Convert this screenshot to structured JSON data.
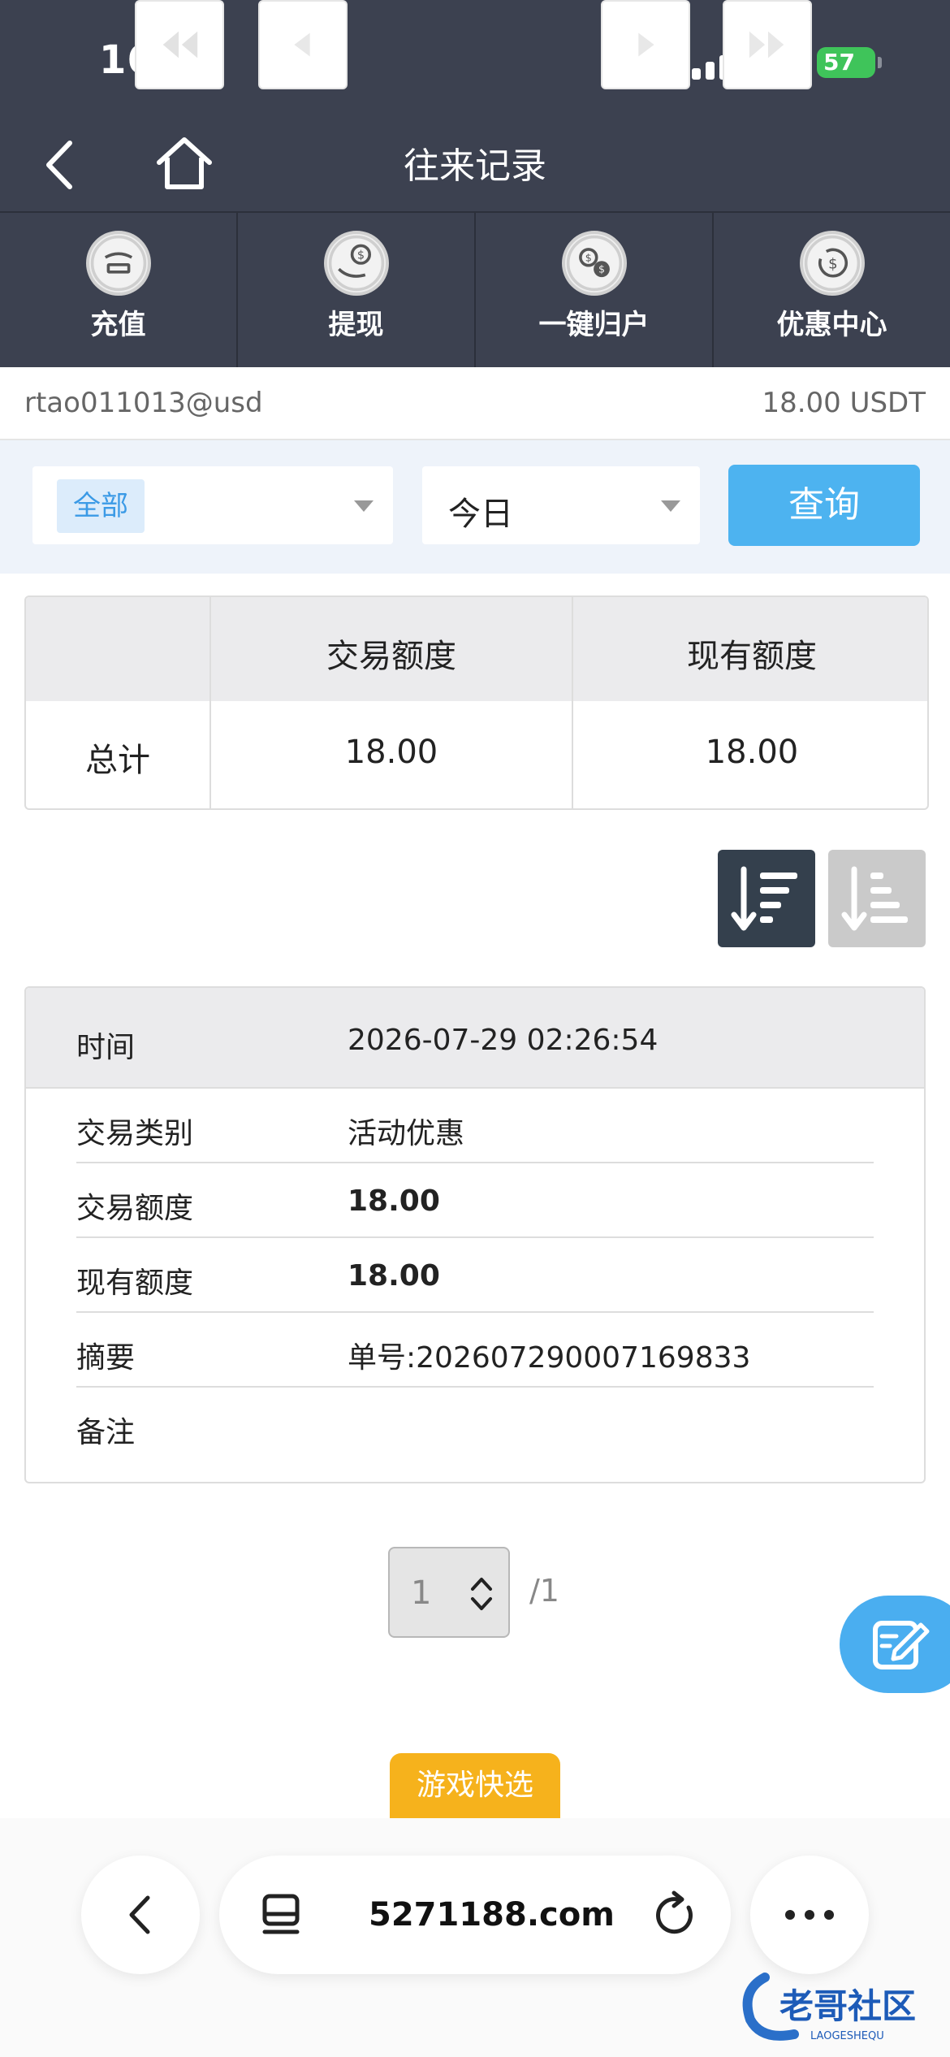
{
  "status_bar": {
    "time": "16:02",
    "battery": "57"
  },
  "nav": {
    "title": "往来记录"
  },
  "quick_actions": [
    {
      "label": "充值",
      "icon": "deposit-icon"
    },
    {
      "label": "提现",
      "icon": "withdraw-icon"
    },
    {
      "label": "一键归户",
      "icon": "transfer-icon"
    },
    {
      "label": "优惠中心",
      "icon": "promo-icon"
    }
  ],
  "account": {
    "username": "rtao011013@usd",
    "balance": "18.00 USDT"
  },
  "filter": {
    "category": "全部",
    "period": "今日",
    "query_label": "查询"
  },
  "summary": {
    "headers": [
      "交易额度",
      "现有额度"
    ],
    "row_label": "总计",
    "values": [
      "18.00",
      "18.00"
    ]
  },
  "record": {
    "time_label": "时间",
    "time_value": "2026-07-29 02:26:54",
    "rows": [
      {
        "key": "交易类别",
        "value": "活动优惠"
      },
      {
        "key": "交易额度",
        "value": "18.00"
      },
      {
        "key": "现有额度",
        "value": "18.00"
      },
      {
        "key": "摘要",
        "value": "单号:202607290007169833"
      },
      {
        "key": "备注",
        "value": ""
      }
    ]
  },
  "pagination": {
    "current": "1",
    "total": "/1"
  },
  "game_quick": "游戏快选",
  "browser": {
    "url": "5271188.com"
  },
  "watermark": {
    "text": "老哥社区",
    "sub": "LAOGESHEQU"
  },
  "colors": {
    "header_bg": "#3c4150",
    "accent": "#4db3f0",
    "sort_active": "#34404d"
  }
}
